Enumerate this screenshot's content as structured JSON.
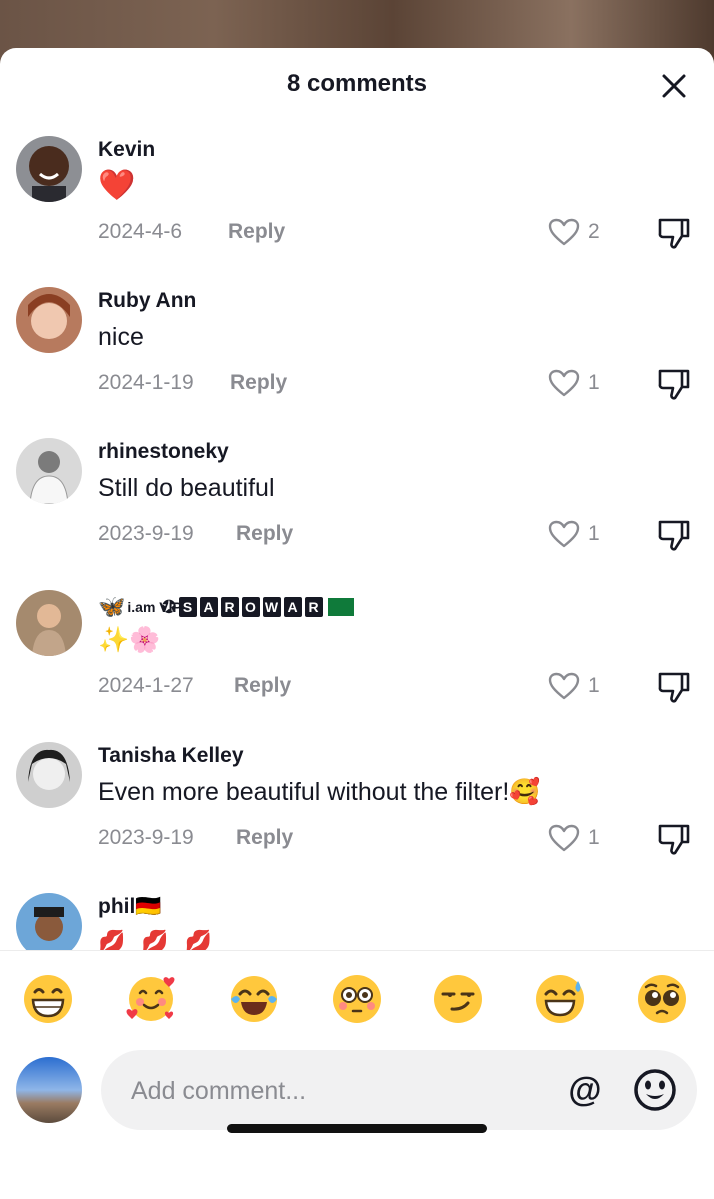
{
  "header": {
    "title": "8 comments"
  },
  "comments": [
    {
      "username": "Kevin",
      "text": "❤️",
      "date": "2024-4-6",
      "reply": "Reply",
      "likes": "2"
    },
    {
      "username": "Ruby Ann",
      "text": "nice",
      "date": "2024-1-19",
      "reply": "Reply",
      "likes": "1"
    },
    {
      "username": "rhinestoneky",
      "text": "Still do beautiful",
      "date": "2023-9-19",
      "reply": "Reply",
      "likes": "1"
    },
    {
      "username": "SAROWAR",
      "username_prefix": "i.am VIP",
      "text": "✨🌸",
      "date": "2024-1-27",
      "reply": "Reply",
      "likes": "1"
    },
    {
      "username": "Tanisha Kelley",
      "text": "Even more beautiful without the filter!🥰",
      "date": "2023-9-19",
      "reply": "Reply",
      "likes": "1"
    },
    {
      "username": "phil🇩🇪",
      "text": "💋💋💋"
    }
  ],
  "emoji_bar": [
    "😁",
    "🥰",
    "😂",
    "😳",
    "😏",
    "😅",
    "🥺"
  ],
  "compose": {
    "placeholder": "Add comment...",
    "at_symbol": "@"
  },
  "colors": {
    "text": "#161823",
    "muted": "#8a8b91",
    "input_bg": "#f1f1f2"
  }
}
